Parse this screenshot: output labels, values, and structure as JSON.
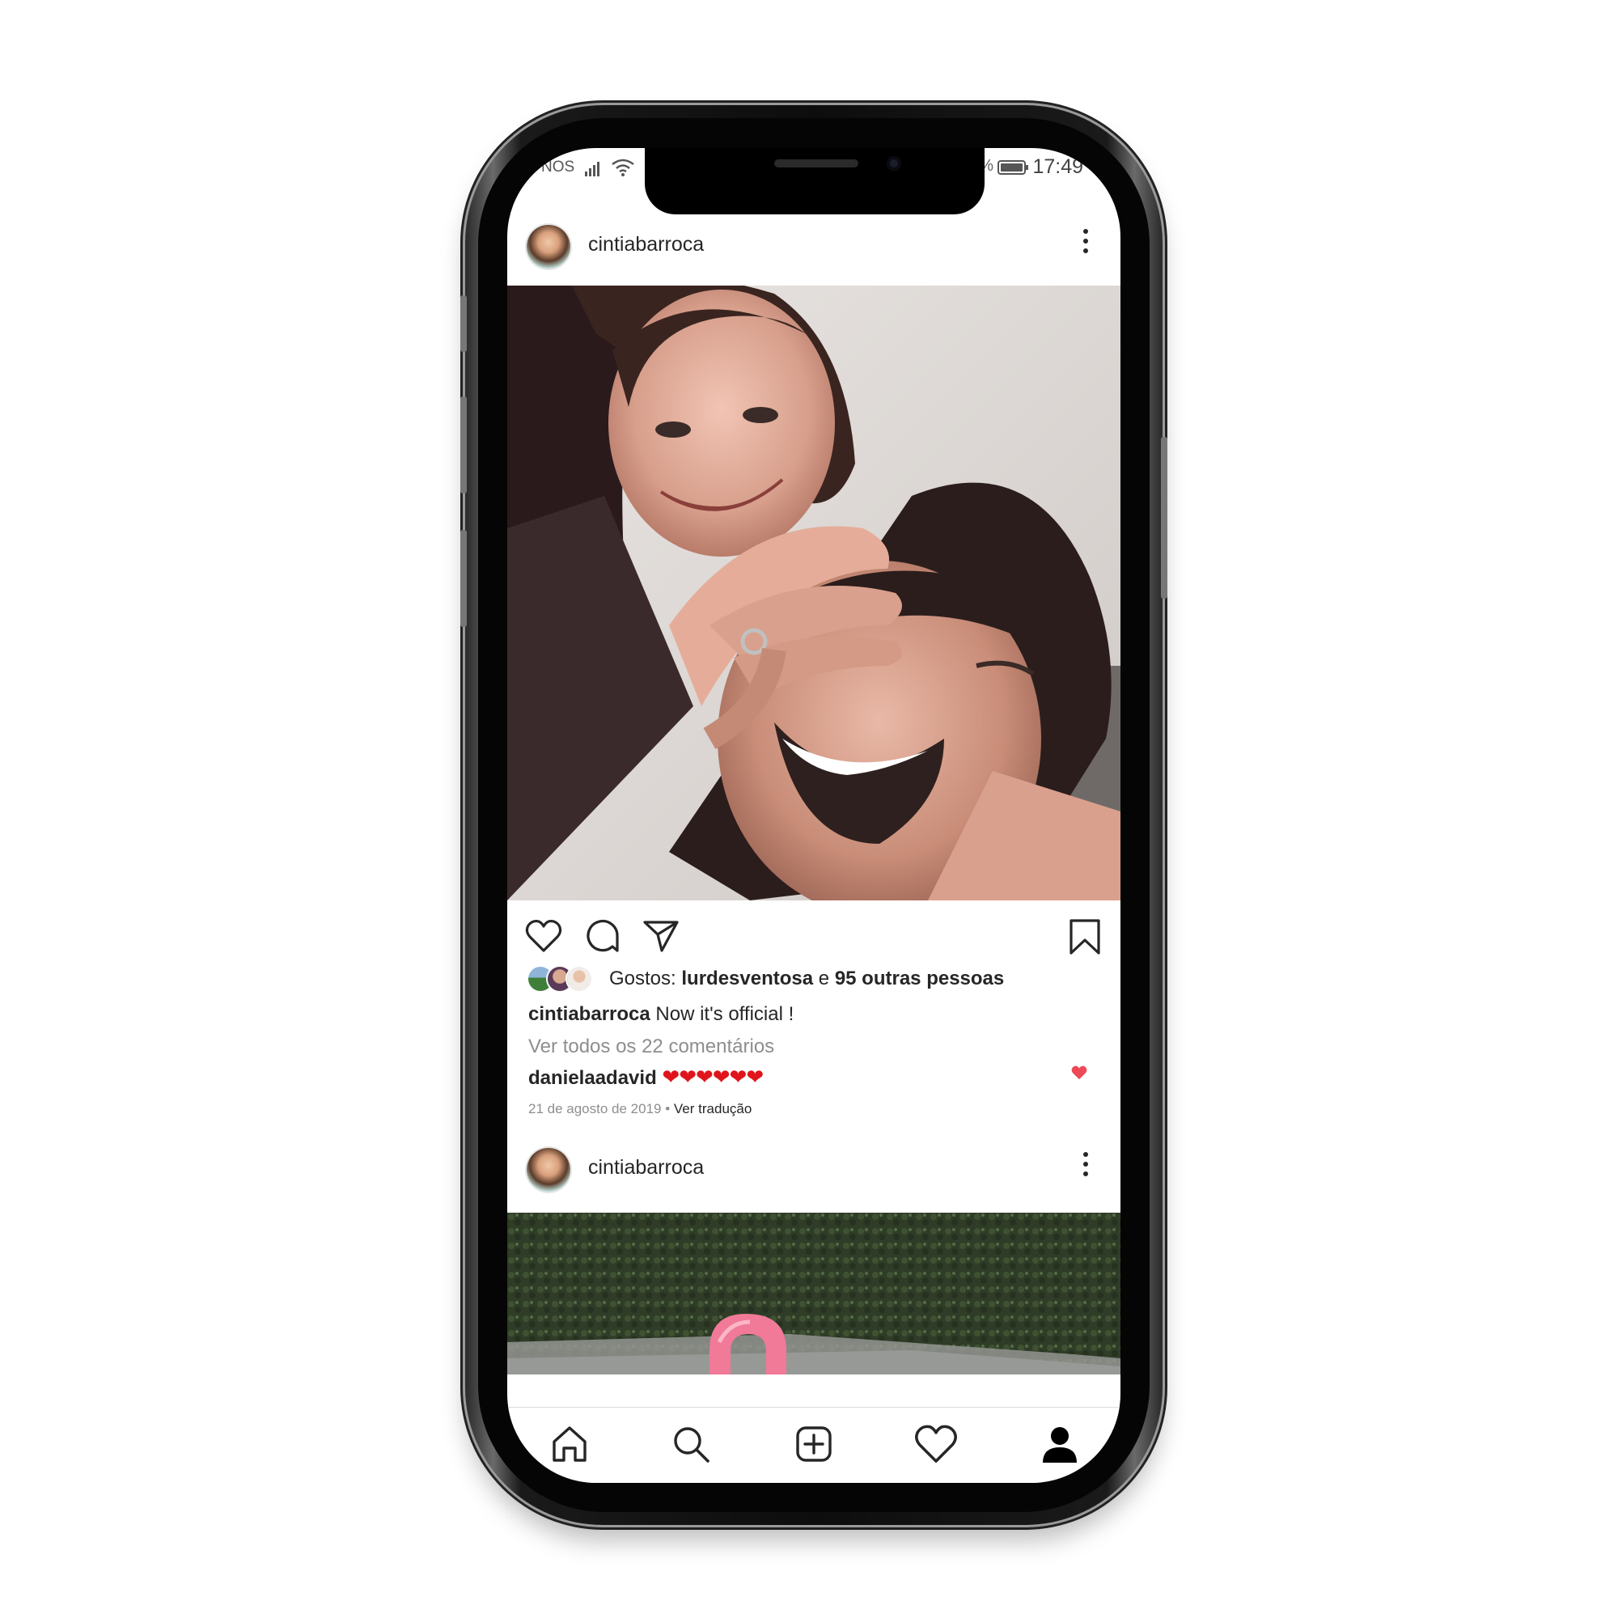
{
  "status_bar": {
    "carrier": "NOS",
    "battery_percent_fragment": "%",
    "time": "17:49"
  },
  "posts": [
    {
      "username": "cintiabarroca",
      "likes": {
        "prefix": "Gostos:",
        "first_user": "lurdesventosa",
        "connector": "e",
        "others": "95 outras pessoas"
      },
      "caption": {
        "username": "cintiabarroca",
        "text": "Now it's official !"
      },
      "view_comments": "Ver todos os 22 comentários",
      "top_comment": {
        "username": "danielaadavid",
        "text": "❤❤❤❤❤❤"
      },
      "date": "21 de agosto de 2019",
      "separator": "•",
      "translate": "Ver tradução"
    },
    {
      "username": "cintiabarroca"
    }
  ],
  "icons": {
    "like": "heart-icon",
    "comment": "comment-icon",
    "share": "paper-plane-icon",
    "save": "bookmark-icon",
    "more": "more-vertical-icon",
    "tab_home": "home-icon",
    "tab_search": "search-icon",
    "tab_new_post": "plus-square-icon",
    "tab_activity": "heart-icon",
    "tab_profile": "profile-icon"
  },
  "colors": {
    "text": "#262626",
    "secondary_text": "#8e8e8e",
    "heart_red": "#e0151b"
  }
}
